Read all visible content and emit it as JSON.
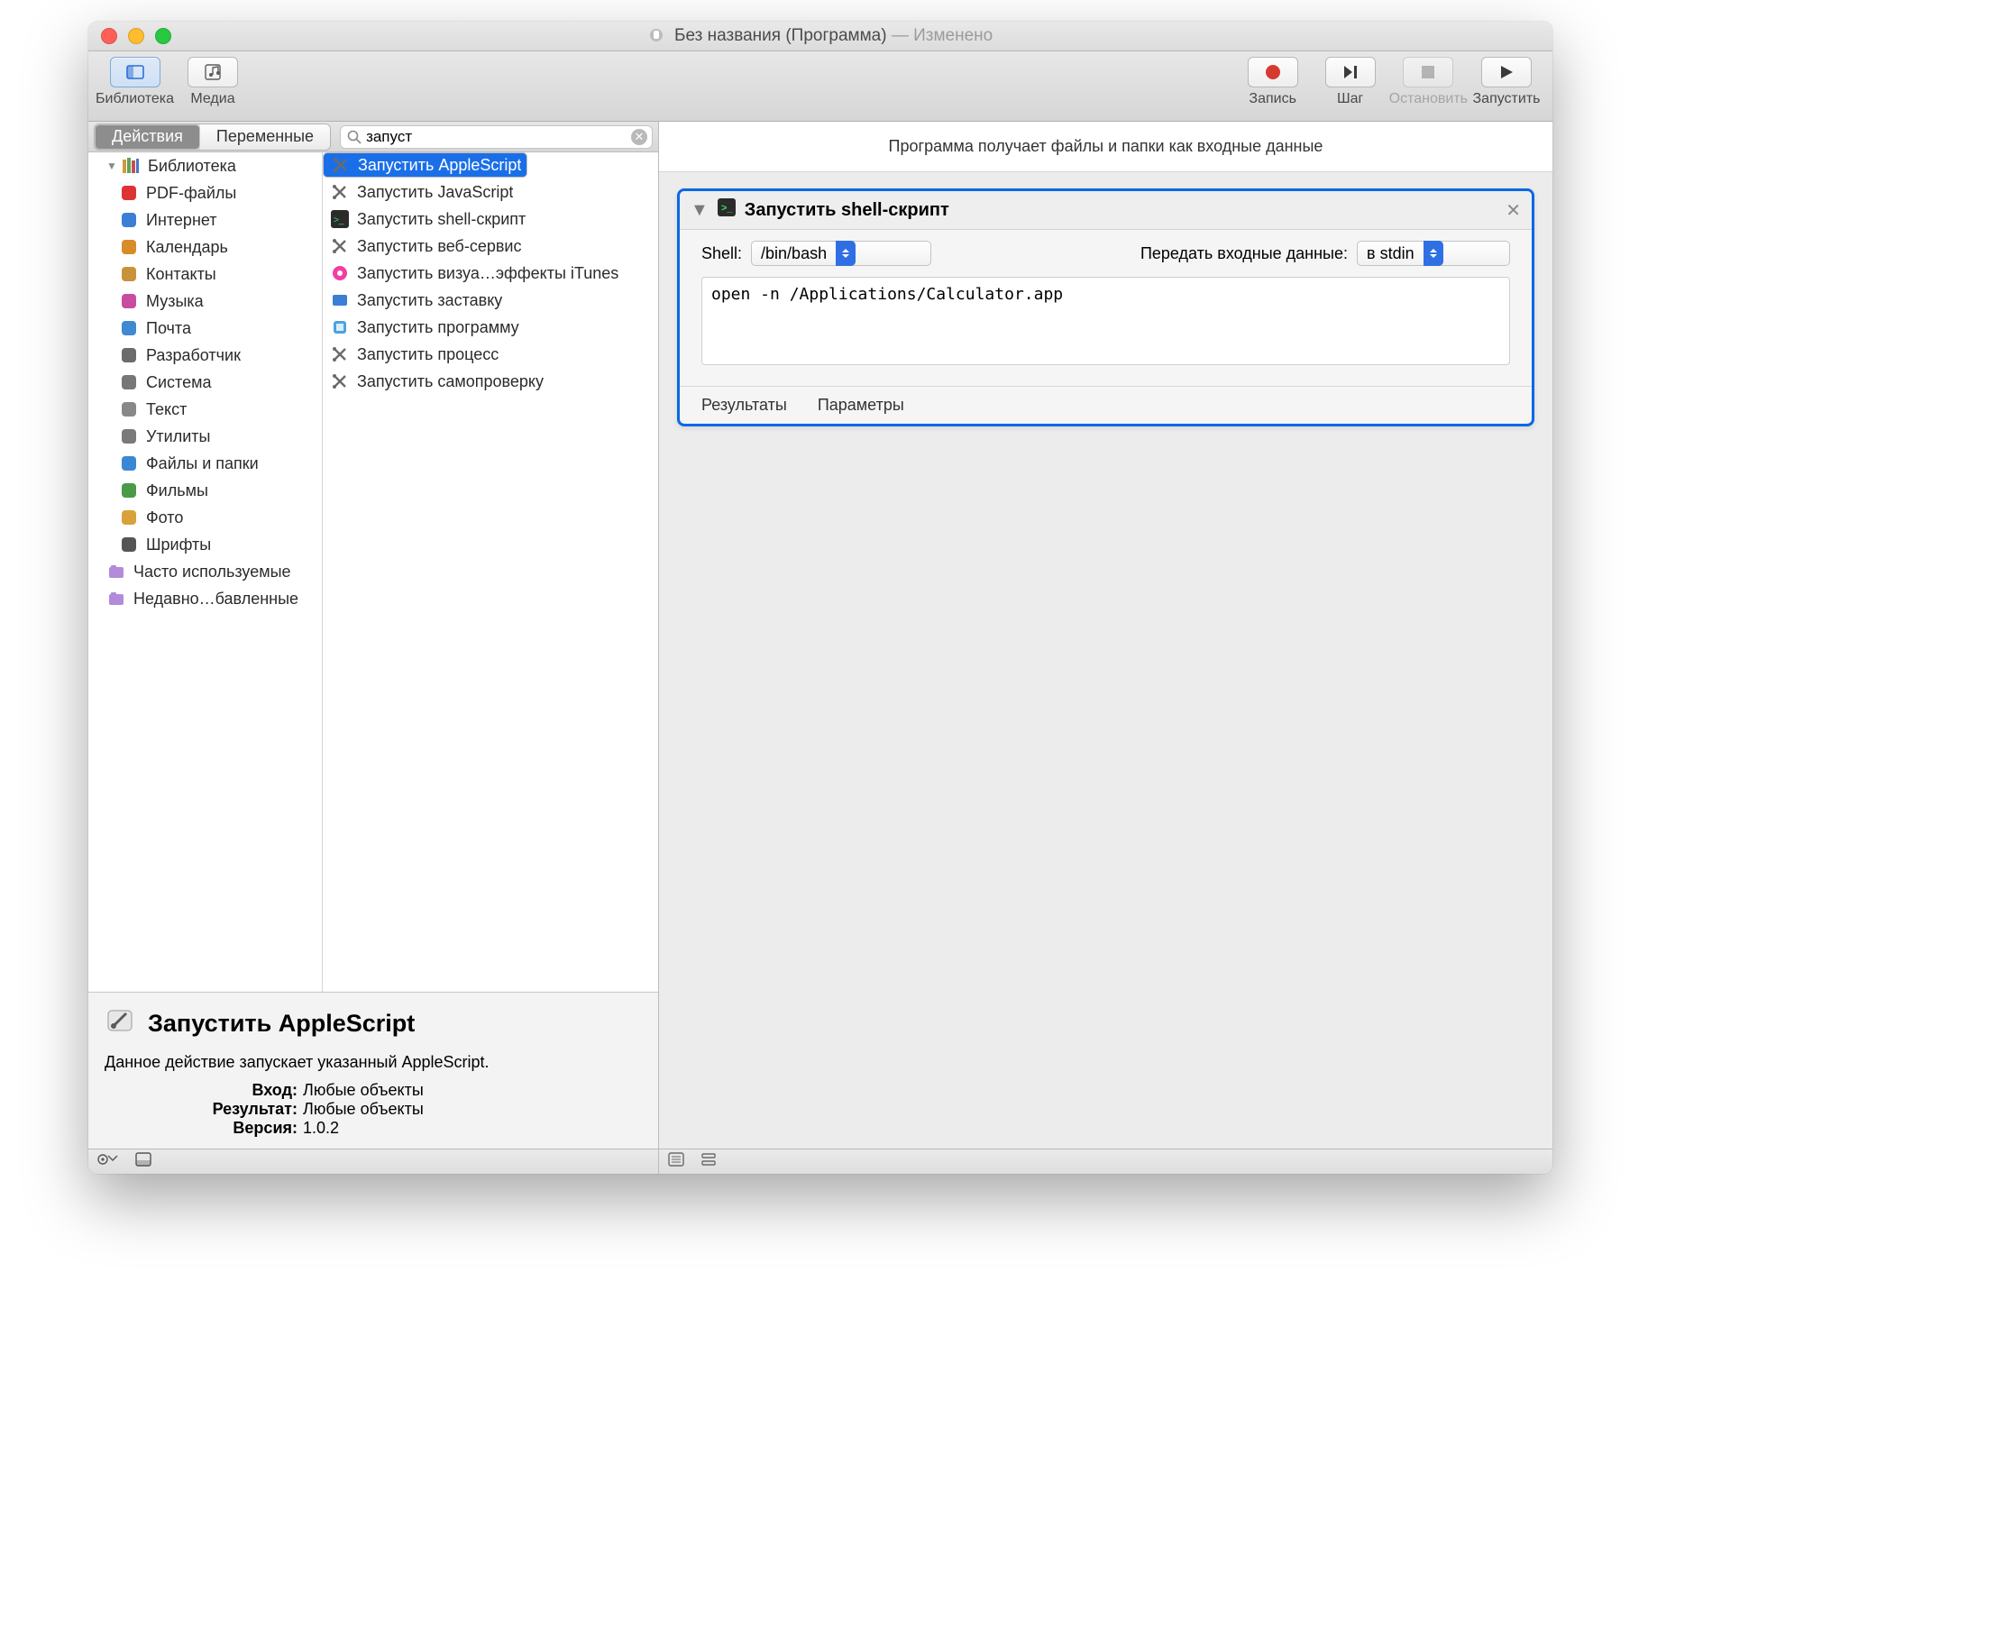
{
  "title": {
    "app_icon": "automator-icon",
    "name": "Без названия (Программа)",
    "status": "Изменено",
    "sep": " — "
  },
  "toolbar": {
    "library": "Библиотека",
    "media": "Медиа",
    "record": "Запись",
    "step": "Шаг",
    "stop": "Остановить",
    "run": "Запустить"
  },
  "left": {
    "tabs": {
      "actions": "Действия",
      "variables": "Переменные"
    },
    "search_value": "запуст",
    "lib_header": "Библиотека",
    "categories": [
      "PDF-файлы",
      "Интернет",
      "Календарь",
      "Контакты",
      "Музыка",
      "Почта",
      "Разработчик",
      "Система",
      "Текст",
      "Утилиты",
      "Файлы и папки",
      "Фильмы",
      "Фото",
      "Шрифты"
    ],
    "smart": [
      "Часто используемые",
      "Недавно…бавленные"
    ],
    "actions": [
      "Запустить AppleScript",
      "Запустить JavaScript",
      "Запустить shell-скрипт",
      "Запустить веб-сервис",
      "Запустить визуа…эффекты iTunes",
      "Запустить заставку",
      "Запустить программу",
      "Запустить процесс",
      "Запустить самопроверку"
    ]
  },
  "detail": {
    "title": "Запустить AppleScript",
    "desc": "Данное действие запускает указанный AppleScript.",
    "input_label": "Вход:",
    "input_value": "Любые объекты",
    "result_label": "Результат:",
    "result_value": "Любые объекты",
    "version_label": "Версия:",
    "version_value": "1.0.2"
  },
  "right": {
    "intro": "Программа получает файлы и папки как входные данные",
    "action": {
      "title": "Запустить shell-скрипт",
      "shell_label": "Shell:",
      "shell_value": "/bin/bash",
      "pass_label": "Передать входные данные:",
      "pass_value": "в stdin",
      "script": "open -n /Applications/Calculator.app",
      "tab_results": "Результаты",
      "tab_params": "Параметры"
    }
  }
}
